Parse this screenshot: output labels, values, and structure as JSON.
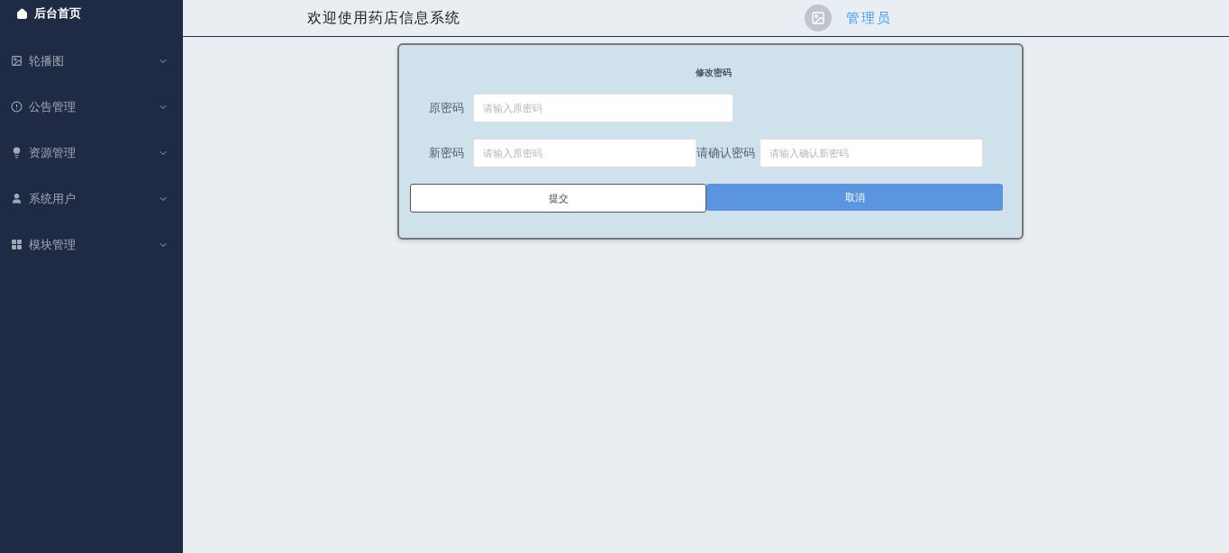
{
  "sidebar": {
    "items": [
      {
        "label": "后台首页",
        "kind": "home",
        "selected": true
      },
      {
        "label": "轮播图",
        "kind": "image",
        "selected": false
      },
      {
        "label": "公告管理",
        "kind": "notice",
        "selected": false
      },
      {
        "label": "资源管理",
        "kind": "resource",
        "selected": false
      },
      {
        "label": "系统用户",
        "kind": "user",
        "selected": false
      },
      {
        "label": "模块管理",
        "kind": "module",
        "selected": false
      }
    ]
  },
  "header": {
    "title": "欢迎使用药店信息系统",
    "user": "管理员"
  },
  "form": {
    "title": "修改密码",
    "rows": [
      [
        {
          "label": "原密码",
          "placeholder": "请输入原密码"
        }
      ],
      [
        {
          "label": "新密码",
          "placeholder": "请输入原密码"
        },
        {
          "label": "请确认密码",
          "placeholder": "请输入确认新密码"
        }
      ]
    ],
    "buttons": [
      {
        "label": "提交",
        "kind": "outline"
      },
      {
        "label": "取消",
        "kind": "primary"
      }
    ]
  }
}
